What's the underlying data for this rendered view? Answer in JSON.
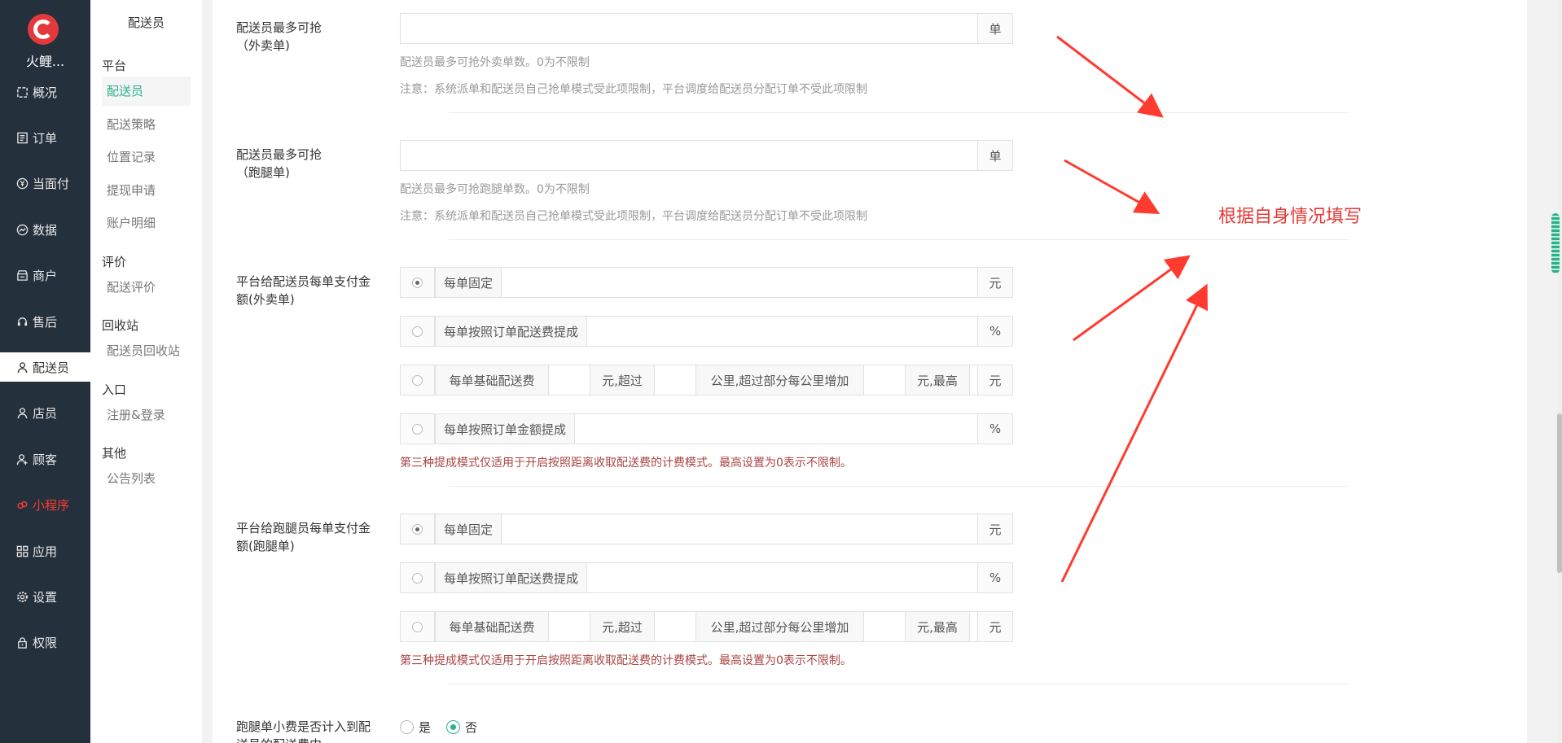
{
  "app": {
    "brand": "火鲤..."
  },
  "nav": [
    {
      "label": "概况",
      "icon": "overview-icon"
    },
    {
      "label": "订单",
      "icon": "order-icon"
    },
    {
      "label": "当面付",
      "icon": "yen-icon"
    },
    {
      "label": "数据",
      "icon": "data-icon"
    },
    {
      "label": "商户",
      "icon": "shop-icon"
    },
    {
      "label": "售后",
      "icon": "service-icon"
    },
    {
      "label": "配送员",
      "icon": "courier-icon",
      "active": true
    },
    {
      "label": "店员",
      "icon": "clerk-icon"
    },
    {
      "label": "顾客",
      "icon": "customer-icon"
    },
    {
      "label": "小程序",
      "icon": "miniprogram-icon",
      "highlight": true
    },
    {
      "label": "应用",
      "icon": "apps-icon"
    },
    {
      "label": "设置",
      "icon": "gear-icon"
    },
    {
      "label": "权限",
      "icon": "lock-icon"
    }
  ],
  "subnav": {
    "title": "配送员",
    "groups": [
      {
        "name": "平台",
        "items": [
          "配送员",
          "配送策略",
          "位置记录",
          "提现申请",
          "账户明细"
        ]
      },
      {
        "name": "评价",
        "items": [
          "配送评价"
        ]
      },
      {
        "name": "回收站",
        "items": [
          "配送员回收站"
        ]
      },
      {
        "name": "入口",
        "items": [
          "注册&登录"
        ]
      },
      {
        "name": "其他",
        "items": [
          "公告列表"
        ]
      }
    ],
    "active_item": "配送员"
  },
  "form": {
    "waimai_max": {
      "label": "配送员最多可抢\n（外卖单)",
      "value": "",
      "unit": "单",
      "hint": "配送员最多可抢外卖单数。0为不限制",
      "note": "注意：系统派单和配送员自己抢单模式受此项限制，平台调度给配送员分配订单不受此项限制"
    },
    "paotui_max": {
      "label": "配送员最多可抢\n（跑腿单)",
      "value": "",
      "unit": "单",
      "hint": "配送员最多可抢跑腿单数。0为不限制",
      "note": "注意：系统派单和配送员自己抢单模式受此项限制，平台调度给配送员分配订单不受此项限制"
    },
    "waimai_pay": {
      "label": "平台给配送员每单支付金\n额(外卖单)",
      "options": [
        {
          "label": "每单固定",
          "unit": "元",
          "checked": true
        },
        {
          "label": "每单按照订单配送费提成",
          "unit": "%"
        },
        {
          "label": "每单基础配送费",
          "seg1": "元,超过",
          "seg2": "公里,超过部分每公里增加",
          "seg3": "元,最高",
          "unit": "元"
        },
        {
          "label": "每单按照订单金额提成",
          "unit": "%"
        }
      ],
      "warn": "第三种提成模式仅适用于开启按照距离收取配送费的计费模式。最高设置为0表示不限制。"
    },
    "paotui_pay": {
      "label": "平台给跑腿员每单支付金\n额(跑腿单)",
      "options": [
        {
          "label": "每单固定",
          "unit": "元",
          "checked": true
        },
        {
          "label": "每单按照订单配送费提成",
          "unit": "%"
        },
        {
          "label": "每单基础配送费",
          "seg1": "元,超过",
          "seg2": "公里,超过部分每公里增加",
          "seg3": "元,最高",
          "unit": "元"
        }
      ],
      "warn": "第三种提成模式仅适用于开启按照距离收取配送费的计费模式。最高设置为0表示不限制。"
    },
    "tip_count": {
      "label": "跑腿单小费是否计入到配\n送员的配送费中",
      "yes": "是",
      "no": "否",
      "selected": "否"
    }
  },
  "annotation": {
    "text": "根据自身情况填写",
    "color": "#e53935"
  },
  "colors": {
    "nav_bg": "#24303c",
    "accent": "#2ab08a",
    "warn": "#a94442",
    "logo": "#e4393c"
  }
}
